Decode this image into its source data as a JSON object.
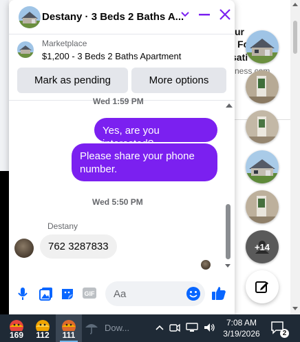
{
  "chat": {
    "title": "Destany · 3 Beds 2 Baths A...",
    "marketplace_label": "Marketplace",
    "listing_title": "$1,200 - 3 Beds 2 Baths Apartment",
    "mark_pending_label": "Mark as pending",
    "more_options_label": "More options",
    "timestamp_top": "Wed 1:59 PM",
    "timestamp_mid": "Wed 5:50 PM",
    "messages_out": [
      "Yes, are you interested?",
      "Please share your phone number."
    ],
    "sender_name": "Destany",
    "message_in": "762 3287833",
    "composer_placeholder": "Aa",
    "colors": {
      "accent": "#7b20f0",
      "icon_blue": "#0866ff"
    }
  },
  "background": {
    "text_lines": [
      "ur",
      "Fo",
      "sati"
    ],
    "url_fragment": "ness.com"
  },
  "chat_heads": {
    "more_count": "+14"
  },
  "taskbar": {
    "apps": [
      {
        "name": "weather-app-1",
        "value": "169"
      },
      {
        "name": "weather-app-2",
        "value": "112"
      },
      {
        "name": "weather-app-3",
        "value": "111"
      }
    ],
    "download_label": "Dow...",
    "time": "7:08 AM",
    "date": "3/19/2026",
    "notification_count": "2"
  }
}
